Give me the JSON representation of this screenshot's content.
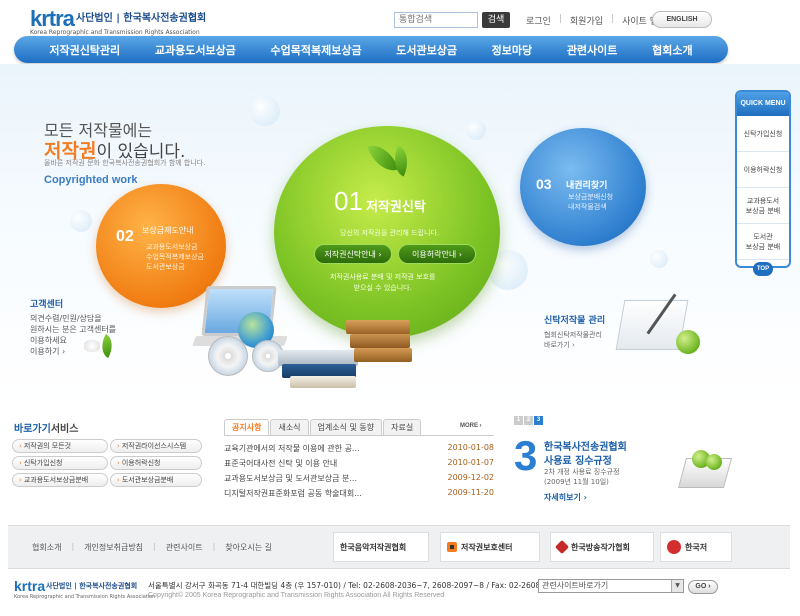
{
  "logo": {
    "mark": "krtra",
    "name_kr": "사단법인 | 한국복사전송권협회",
    "name_en": "Korea Reprographic and Transmission Rights Association"
  },
  "header": {
    "search_placeholder": "통합검색",
    "search_button": "검색",
    "links": [
      "로그인",
      "회원가입",
      "사이트 맵"
    ],
    "english_button": "ENGLISH"
  },
  "gnb": [
    "저작권신탁관리",
    "교과용도서보상금",
    "수업목적복제보상금",
    "도서관보상금",
    "정보마당",
    "관련사이트",
    "협회소개"
  ],
  "hero": {
    "line1": "모든 저작물에는",
    "line2_em": "저작권",
    "line2_rest": "이 있습니다.",
    "sub": "올바른 저작권 문화 한국복사전송권협회가 함께 합니다.",
    "copy": "Copyrighted work"
  },
  "circle_02": {
    "num": "02",
    "title": "보상금제도안내",
    "items": [
      "교과용도서보상금",
      "수업목적복제보상금",
      "도서관보상금"
    ]
  },
  "circle_01": {
    "num": "01",
    "title": "저작권신탁",
    "sub": "당신의 저작권을 관리해 드립니다.",
    "button1": "저작권신탁안내 ›",
    "button2": "이용허락안내 ›",
    "desc": [
      "저작권사용료 분배 및 저작권 보호를",
      "받으실 수 있습니다."
    ]
  },
  "circle_03": {
    "num": "03",
    "title": "내권리찾기",
    "items": [
      "보상금분배신청",
      "내저작물검색"
    ]
  },
  "customer": {
    "title": "고객센터",
    "desc": [
      "의견수렴/민원/상담을",
      "원하시는 분은 고객센터를",
      "이용하세요",
      "이용하기 ›"
    ]
  },
  "trust_works": {
    "title": "신탁저작물 관리",
    "desc": [
      "협회신탁저작물관리",
      "바로가기 ›"
    ]
  },
  "quick_menu": {
    "title": "QUICK MENU",
    "items": [
      "신탁가입신청",
      "이용허락신청",
      "교과용도서\n보상금 분배",
      "도서관\n보상금 분배"
    ],
    "top": "TOP"
  },
  "shortcuts": {
    "title_em": "바로가기",
    "title_rest": "서비스",
    "items": [
      "저작권의 모든것",
      "저작권라이선스시스템",
      "신탁가입신청",
      "이용허락신청",
      "교과용도서보상금분배",
      "도서관보상금분배"
    ]
  },
  "notice": {
    "tabs": [
      "공지사항",
      "새소식",
      "업계소식 및 동향",
      "자료실"
    ],
    "more": "MORE ›",
    "rows": [
      {
        "title": "교육기관에서의 저작물 이용에 관한 공...",
        "date": "2010-01-08"
      },
      {
        "title": "표준국어대사전 신탁 및 이용 안내",
        "date": "2010-01-07"
      },
      {
        "title": "교과용도서보상금 및 도서관보상금 분...",
        "date": "2009-12-02"
      },
      {
        "title": "디지털저작권표준화포럼 공동 학술대회...",
        "date": "2009-11-20"
      }
    ]
  },
  "fee_rule": {
    "tabs": [
      "1",
      "2",
      "3"
    ],
    "big": "3",
    "title1": "한국복사전송권협회",
    "title2": "사용료 징수규정",
    "desc1": "2차 개정 사용료 징수규정",
    "desc2": "(2009년 11월 10일)",
    "link": "자세히보기 ›"
  },
  "footer": {
    "links": [
      "협회소개",
      "개인정보취급방침",
      "관련사이트",
      "찾아오시는 길"
    ],
    "partners": [
      "한국음악저작권협회",
      "저작권보호센터",
      "한국방송작가협회",
      "한국저"
    ],
    "address": "서울특별시 강서구 화곡동 71-4 대한빌딩 4층 (우 157-010) / Tel: 02-2608-2036~7, 2608-2097~8 / Fax: 02-2608-2031",
    "copyright": "Copyright© 2005 Korea Reprographic and Transmission Rights Association All Rights Reserved",
    "select": "관련사이트바로가기",
    "go": "GO ›"
  },
  "colors": {
    "brand": "#1d6fb8",
    "accent": "#f47b20",
    "green": "#7cc324"
  }
}
